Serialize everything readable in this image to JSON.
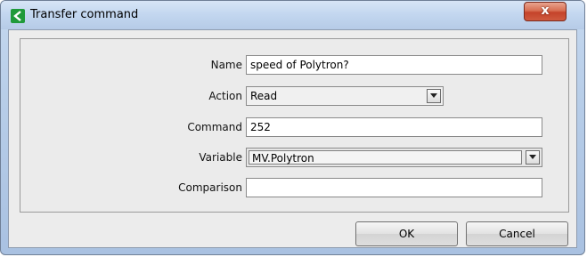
{
  "window": {
    "title": "Transfer command",
    "close_label": "x"
  },
  "form": {
    "name": {
      "label": "Name",
      "value": "speed of Polytron?"
    },
    "action": {
      "label": "Action",
      "value": "Read"
    },
    "command": {
      "label": "Command",
      "value": "252"
    },
    "variable": {
      "label": "Variable",
      "value": "MV.Polytron"
    },
    "comparison": {
      "label": "Comparison",
      "value": ""
    }
  },
  "buttons": {
    "ok": "OK",
    "cancel": "Cancel"
  },
  "colors": {
    "title_icon": "#1f9a3a",
    "close_button": "#c4432a",
    "window_frame": "#b7cde8"
  },
  "icons": {
    "title": "transfer-arrow-icon",
    "close": "close-icon",
    "dropdown": "chevron-down-icon"
  }
}
